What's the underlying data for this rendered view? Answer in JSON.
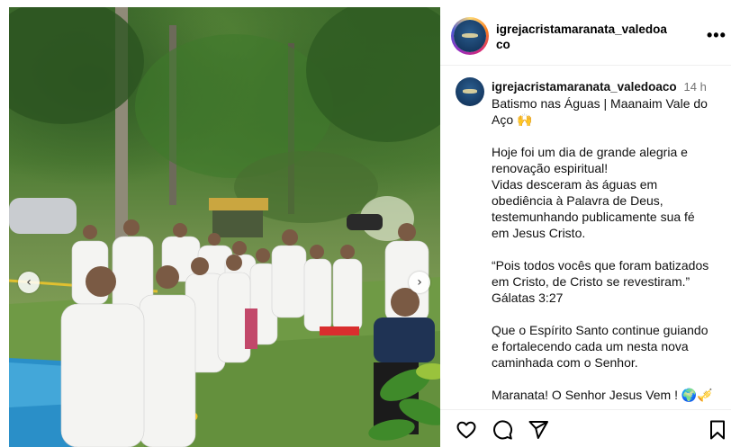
{
  "post": {
    "username": "igrejacristamaranata_valedoaco",
    "username_wrapped_line1": "igrejacristamaranata_valedoa",
    "username_wrapped_line2": "co",
    "more_label": "•••",
    "time": "14 h",
    "caption_lines": [
      [
        "Batismo nas Águas | Maanaim Vale do",
        "Aço 🙌"
      ],
      [
        "Hoje foi um dia de grande alegria e",
        "renovação espiritual!",
        "Vidas desceram às águas em",
        "obediência à Palavra de Deus,",
        "testemunhando publicamente sua fé",
        "em Jesus Cristo."
      ],
      [
        "“Pois todos vocês que foram batizados",
        "em Cristo, de Cristo se revestiram.”",
        "Gálatas 3:27"
      ],
      [
        "Que o Espírito Santo continue guiando",
        "e fortalecendo cada um nesta nova",
        "caminhada com o Senhor."
      ],
      [
        "Maranata! O Senhor Jesus Vem ! 🌍🎺"
      ]
    ]
  },
  "icons": {
    "prev": "chevron-left-icon",
    "next": "chevron-right-icon",
    "like": "heart-icon",
    "comment": "comment-icon",
    "share": "send-icon",
    "save": "bookmark-icon",
    "more": "more-icon"
  },
  "colors": {
    "ring_start": "#feda75",
    "ring_end": "#4f5bd5",
    "time_gray": "#737373",
    "border": "#efefef"
  }
}
